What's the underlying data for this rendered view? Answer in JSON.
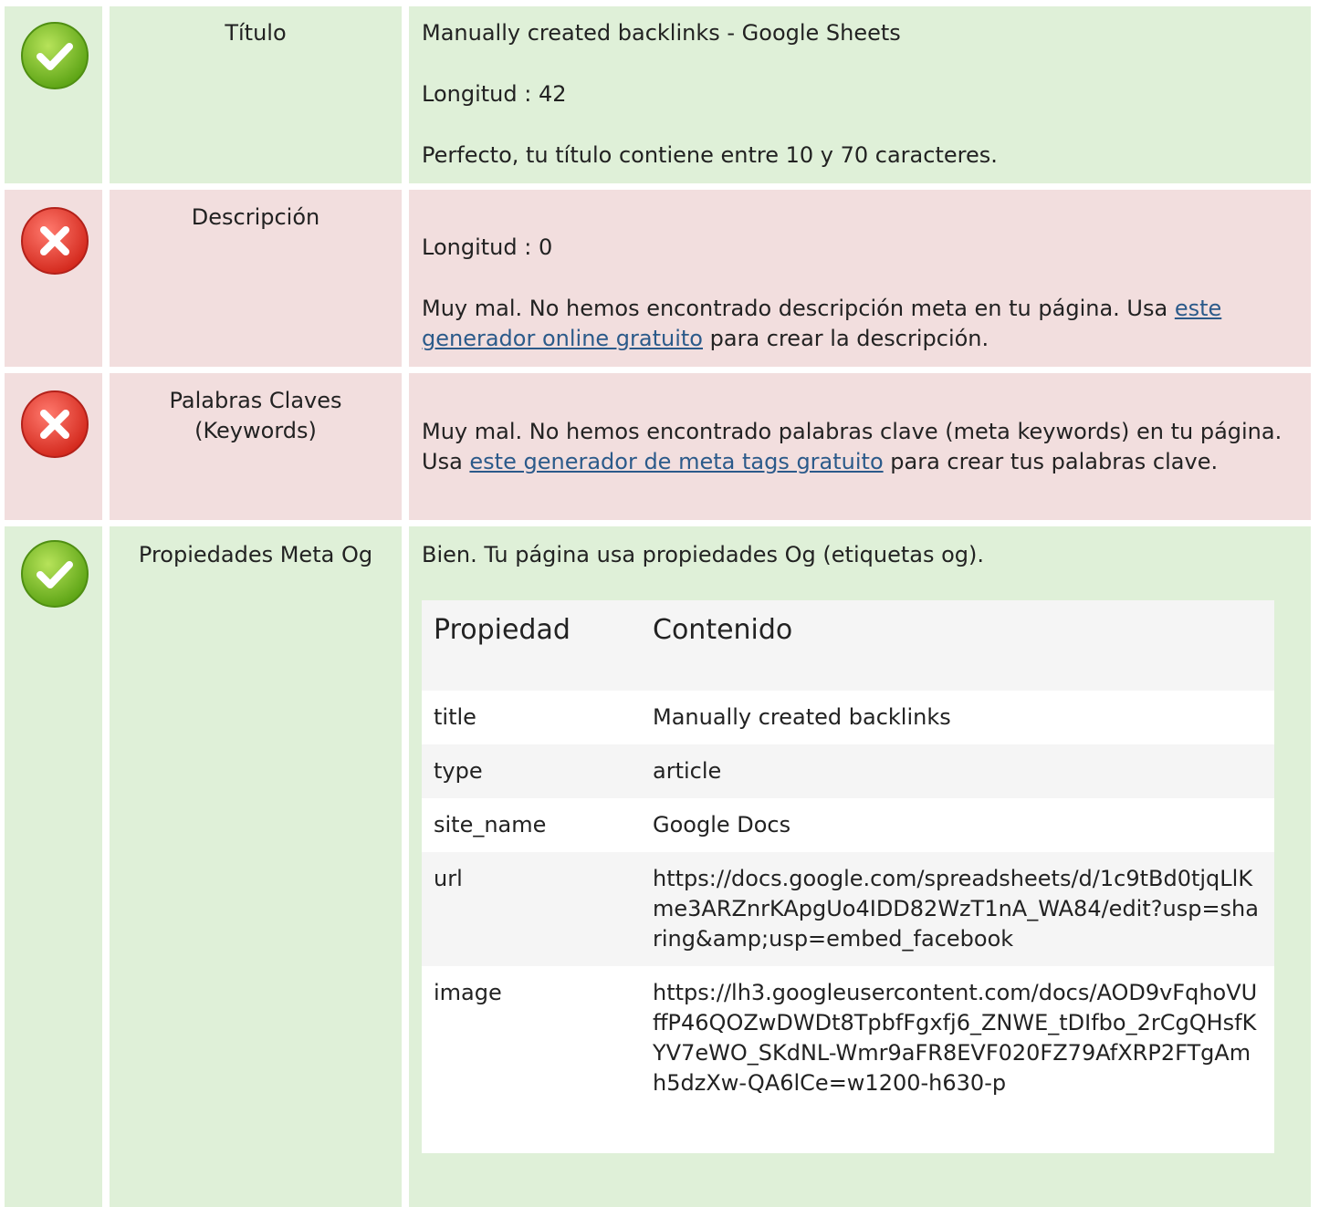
{
  "colors": {
    "success": "#dff0d8",
    "error": "#f2dede",
    "link": "#2b5a8a"
  },
  "rows": {
    "title": {
      "status": "ok",
      "status_icon": "check-icon",
      "label": "Título",
      "value": "Manually created backlinks - Google Sheets",
      "length": "Longitud : 42",
      "message": "Perfecto, tu título contiene entre 10 y 70 caracteres."
    },
    "description": {
      "status": "error",
      "status_icon": "error-x-icon",
      "label": "Descripción",
      "length": "Longitud : 0",
      "message_pre": "Muy mal. No hemos encontrado descripción meta en tu página. Usa ",
      "link": "este generador online gratuito",
      "message_post": " para crear la descripción."
    },
    "keywords": {
      "status": "error",
      "status_icon": "error-x-icon",
      "label_line1": "Palabras Claves",
      "label_line2": "(Keywords)",
      "message_pre": "Muy mal. No hemos encontrado palabras clave (meta keywords) en tu página. Usa ",
      "link": "este generador de meta tags gratuito",
      "message_post": " para crear tus palabras clave."
    },
    "og": {
      "status": "ok",
      "status_icon": "check-icon",
      "label": "Propiedades Meta Og",
      "message": "Bien. Tu página usa propiedades Og (etiquetas og).",
      "table": {
        "headers": [
          "Propiedad",
          "Contenido"
        ],
        "rows": [
          {
            "property": "title",
            "content": "Manually created backlinks"
          },
          {
            "property": "type",
            "content": "article"
          },
          {
            "property": "site_name",
            "content": "Google Docs"
          },
          {
            "property": "url",
            "content": "https://docs.google.com/spreadsheets/d/1c9tBd0tjqLlKme3ARZnrKApgUo4IDD82WzT1nA_WA84/edit?usp=sharing&amp;usp=embed_facebook"
          },
          {
            "property": "image",
            "content": "https://lh3.googleusercontent.com/docs/AOD9vFqhoVUffP46QOZwDWDt8TpbfFgxfj6_ZNWE_tDIfbo_2rCgQHsfKYV7eWO_SKdNL-Wmr9aFR8EVF020FZ79AfXRP2FTgAmh5dzXw-QA6lCe=w1200-h630-p"
          }
        ]
      }
    }
  }
}
